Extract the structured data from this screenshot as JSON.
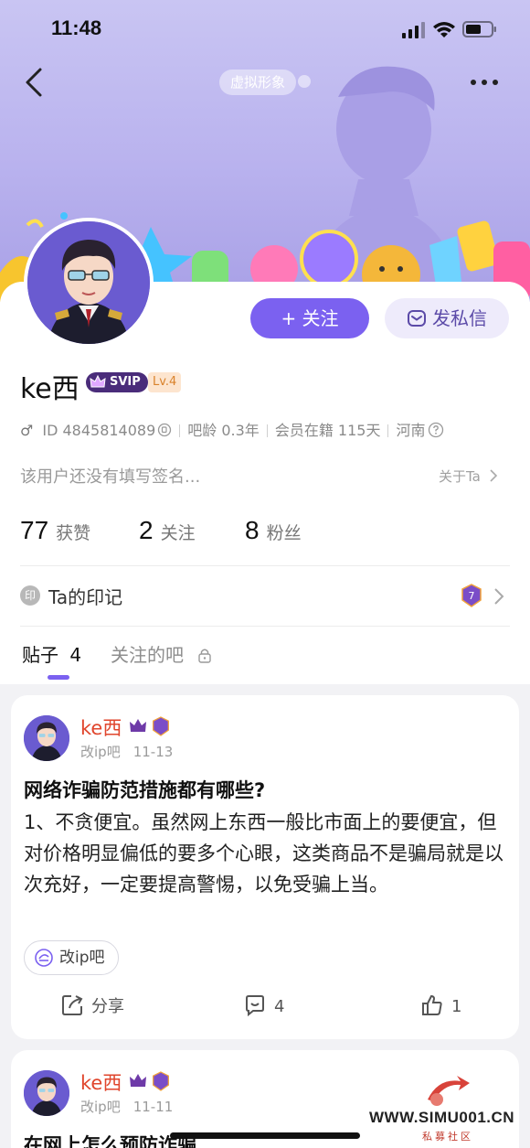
{
  "status_bar": {
    "time": "11:48"
  },
  "header": {
    "avatar_tag": "虚拟形象"
  },
  "profile": {
    "username": "ke西",
    "svip_label": "SVIP",
    "level": "Lv.4",
    "follow_button": "+ 关注",
    "message_button": "发私信",
    "gender_symbol": "♂",
    "id_text": "ID 4845814089",
    "bar_age": "吧龄 0.3年",
    "member_days": "会员在籍 115天",
    "location": "河南",
    "signature": "该用户还没有填写签名...",
    "about_link": "关于Ta"
  },
  "stats": [
    {
      "value": "77",
      "label": "获赞"
    },
    {
      "value": "2",
      "label": "关注"
    },
    {
      "value": "8",
      "label": "粉丝"
    }
  ],
  "marks": {
    "icon_char": "印",
    "label": "Ta的印记"
  },
  "tabs": {
    "posts": "贴子",
    "posts_count": "4",
    "followed_bars": "关注的吧"
  },
  "posts": [
    {
      "author": "ke西",
      "forum": "改ip吧",
      "date": "11-13",
      "title": "网络诈骗防范措施都有哪些?",
      "body": "1、不贪便宜。虽然网上东西一般比市面上的要便宜，但对价格明显偏低的要多个心眼，这类商品不是骗局就是以次充好，一定要提高警惕，以免受骗上当。",
      "forum_pill": "改ip吧",
      "share_label": "分享",
      "comment_count": "4",
      "like_count": "1"
    },
    {
      "author": "ke西",
      "forum": "改ip吧",
      "date": "11-11",
      "title": "在网上怎么预防诈骗"
    }
  ],
  "watermark": {
    "text": "WWW.SIMU001.CN",
    "sub": "私募社区"
  },
  "colors": {
    "accent": "#7b61f0",
    "author_red": "#e0452c",
    "banner": "#b9b2ee"
  }
}
